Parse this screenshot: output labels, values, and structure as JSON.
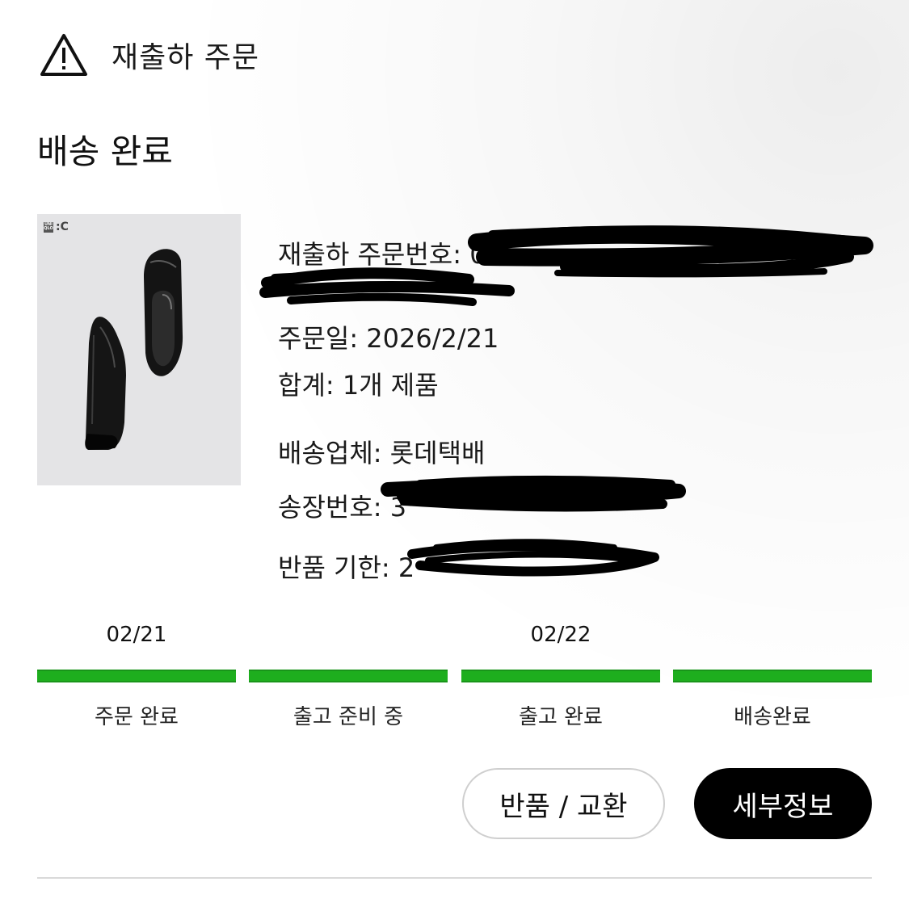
{
  "header": {
    "warning_icon": "warning-triangle-icon",
    "order_type": "재출하 주문"
  },
  "status_title": "배송 완료",
  "product": {
    "brand": "UNI QLO : C",
    "brand_box_top": "UNI",
    "brand_box_bottom": "QLO",
    "brand_suffix": ":C",
    "image": "black-leather-shoes"
  },
  "order_info": {
    "order_number_label": "재출하 주문번호: ",
    "order_number_visible": "05",
    "order_date": "주문일: 2026/2/21",
    "total": "합계: 1개 제품",
    "carrier": "배송업체: 롯데택배",
    "tracking_label": "송장번호: ",
    "tracking_visible": "3",
    "return_deadline_label": "반품 기한: ",
    "return_deadline_visible": "2"
  },
  "progress": {
    "color": "#1eae1e",
    "dates": [
      {
        "label": "02/21"
      },
      {
        "label": ""
      },
      {
        "label": "02/22"
      },
      {
        "label": ""
      }
    ],
    "steps": [
      {
        "label": "주문 완료",
        "done": true
      },
      {
        "label": "출고 준비 중",
        "done": true
      },
      {
        "label": "출고 완료",
        "done": true
      },
      {
        "label": "배송완료",
        "done": true
      }
    ]
  },
  "actions": {
    "return_exchange": "반품 / 교환",
    "details": "세부정보"
  }
}
